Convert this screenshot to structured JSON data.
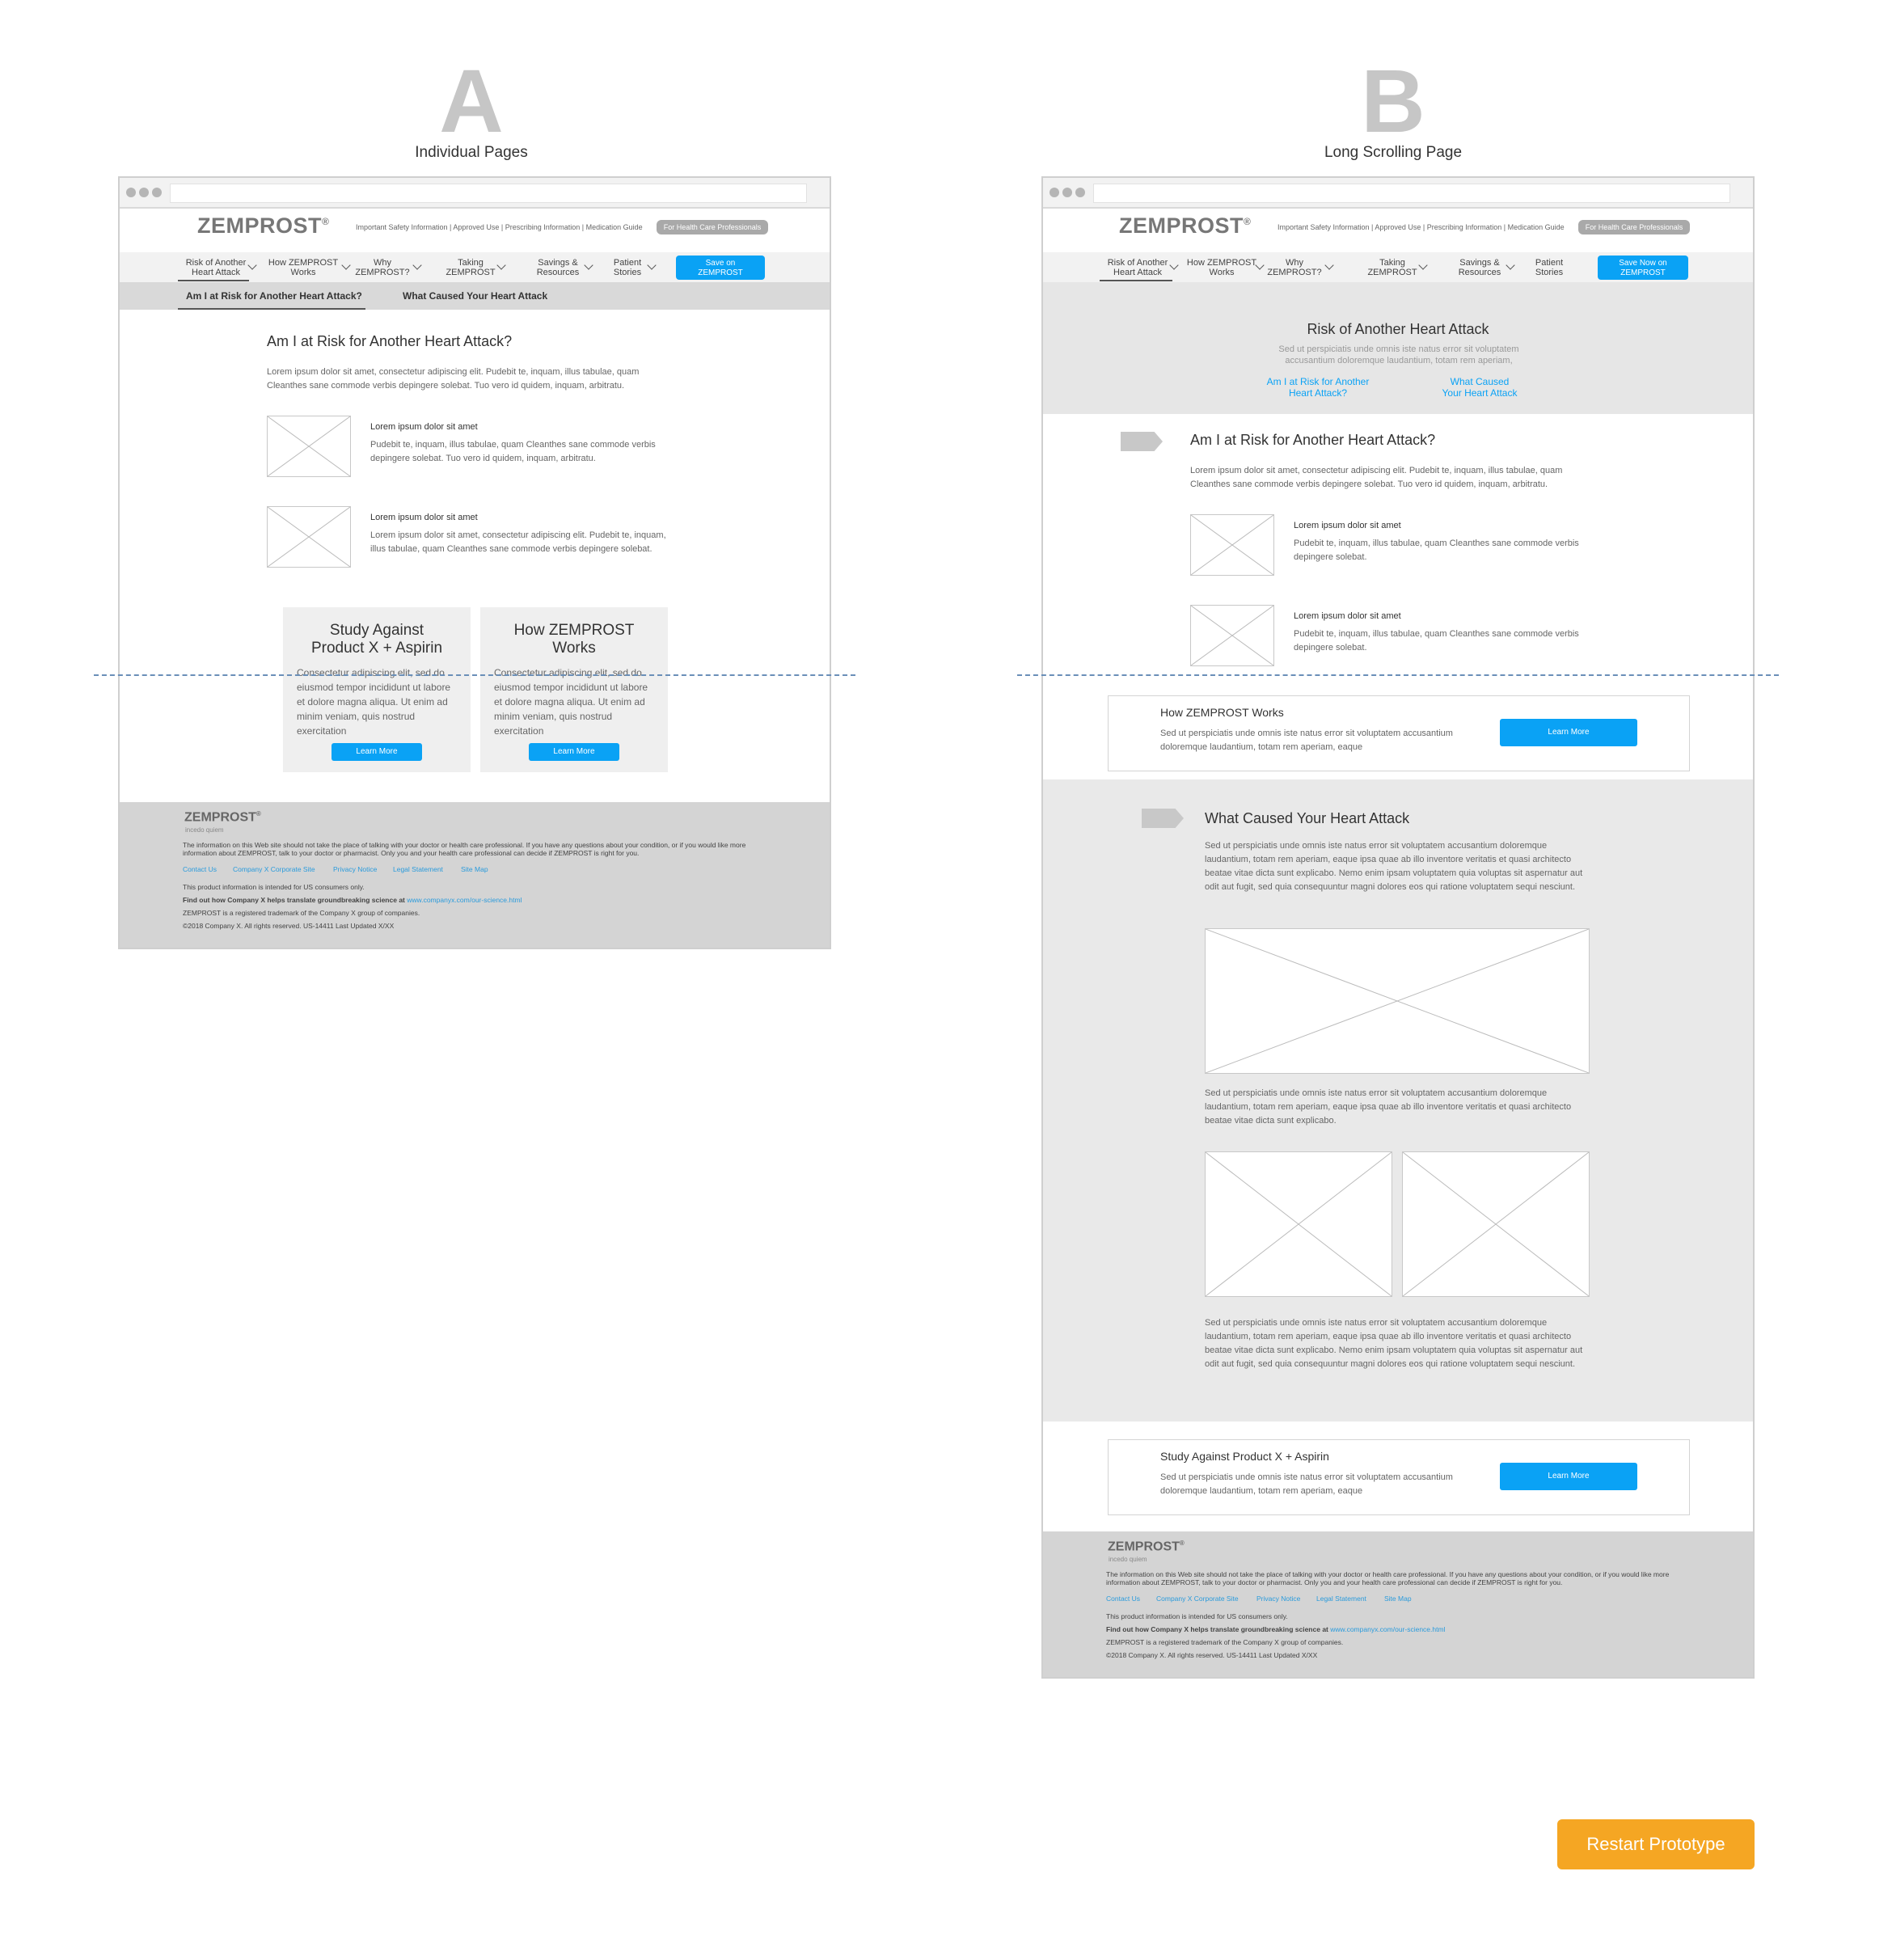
{
  "variant_a": {
    "letter": "A",
    "caption": "Individual Pages"
  },
  "variant_b": {
    "letter": "B",
    "caption": "Long Scrolling Page"
  },
  "brand": {
    "logo": "ZEMPROST",
    "reg": "®",
    "footer_tagline": "incedo quiem"
  },
  "top_links": "Important Safety Information | Approved Use | Prescribing Information | Medication Guide",
  "hcp_button": "For Health Care Professionals",
  "nav": [
    {
      "line1": "Risk of Another",
      "line2": "Heart Attack"
    },
    {
      "line1": "How ZEMPROST",
      "line2": "Works"
    },
    {
      "line1": "Why",
      "line2": "ZEMPROST?"
    },
    {
      "line1": "Taking",
      "line2": "ZEMPROST"
    },
    {
      "line1": "Savings &",
      "line2": "Resources"
    },
    {
      "line1": "Patient",
      "line2": "Stories"
    }
  ],
  "cta_a": {
    "line1": "Save on",
    "line2": "ZEMPROST"
  },
  "cta_b": {
    "line1": "Save Now on",
    "line2": "ZEMPROST"
  },
  "subnav_a": [
    "Am I at Risk for Another Heart Attack?",
    "What Caused Your Heart Attack"
  ],
  "page_a": {
    "heading": "Am I at Risk for Another Heart Attack?",
    "intro": "Lorem ipsum dolor sit amet, consectetur adipiscing elit. Pudebit te, inquam, illus tabulae, quam Cleanthes sane commode verbis depingere solebat. Tuo vero id quidem, inquam, arbitratu.",
    "item1_title": "Lorem ipsum dolor sit amet",
    "item1_text": "Pudebit te, inquam, illus tabulae, quam Cleanthes sane commode verbis depingere solebat. Tuo vero id quidem, inquam, arbitratu.",
    "item2_title": "Lorem ipsum dolor sit amet",
    "item2_text": "Lorem ipsum dolor sit amet, consectetur adipiscing elit. Pudebit te, inquam, illus tabulae, quam Cleanthes sane commode verbis depingere solebat.",
    "card1_title": "Study Against Product X + Aspirin",
    "card2_title": "How ZEMPROST Works",
    "card_text": "Consectetur adipiscing elit, sed do eiusmod tempor incididunt ut labore et dolore magna aliqua. Ut enim ad minim veniam, quis nostrud exercitation",
    "learn_more": "Learn More"
  },
  "page_b": {
    "hero_title": "Risk of Another Heart Attack",
    "hero_text": "Sed ut perspiciatis unde omnis iste natus error sit voluptatem accusantium doloremque laudantium, totam rem aperiam,",
    "hero_link1_l1": "Am I at Risk for Another",
    "hero_link1_l2": "Heart Attack?",
    "hero_link2_l1": "What Caused",
    "hero_link2_l2": "Your Heart Attack",
    "section1_heading": "Am I at Risk for Another Heart Attack?",
    "section1_intro": "Lorem ipsum dolor sit amet, consectetur adipiscing elit. Pudebit te, inquam, illus tabulae, quam Cleanthes sane commode verbis depingere solebat. Tuo vero id quidem, inquam, arbitratu.",
    "item1_title": "Lorem ipsum dolor sit amet",
    "item1_text": "Pudebit te, inquam, illus tabulae, quam Cleanthes sane commode verbis depingere solebat.",
    "item2_title": "Lorem ipsum dolor sit amet",
    "item2_text": "Pudebit te, inquam, illus tabulae, quam Cleanthes sane commode verbis depingere solebat.",
    "promo1_title": "How ZEMPROST Works",
    "promo_text": "Sed ut perspiciatis unde omnis iste natus error sit voluptatem accusantium doloremque laudantium, totam rem aperiam, eaque",
    "section2_heading": "What Caused Your Heart Attack",
    "section2_p1": "Sed ut perspiciatis unde omnis iste natus error sit voluptatem accusantium doloremque laudantium, totam rem aperiam, eaque ipsa quae ab illo inventore veritatis et quasi architecto beatae vitae dicta sunt explicabo. Nemo enim ipsam voluptatem quia voluptas sit aspernatur aut odit aut fugit, sed quia consequuntur magni dolores eos qui ratione voluptatem sequi nesciunt.",
    "section2_p2": "Sed ut perspiciatis unde omnis iste natus error sit voluptatem accusantium doloremque laudantium, totam rem aperiam, eaque ipsa quae ab illo inventore veritatis et quasi architecto beatae vitae dicta sunt explicabo.",
    "section2_p3": "Sed ut perspiciatis unde omnis iste natus error sit voluptatem accusantium doloremque laudantium, totam rem aperiam, eaque ipsa quae ab illo inventore veritatis et quasi architecto beatae vitae dicta sunt explicabo. Nemo enim ipsam voluptatem quia voluptas sit aspernatur aut odit aut fugit, sed quia consequuntur magni dolores eos qui ratione voluptatem sequi nesciunt.",
    "promo2_title": "Study Against Product X + Aspirin",
    "learn_more": "Learn More"
  },
  "footer": {
    "disclaimer": "The information on this Web site should not take the place of talking with your doctor or health care professional. If you have any questions about your condition, or if you would like more information about ZEMPROST, talk to your doctor or pharmacist. Only you and your health care professional can decide if ZEMPROST is right for you.",
    "links": [
      "Contact Us",
      "Company X Corporate Site",
      "Privacy Notice",
      "Legal Statement",
      "Site Map"
    ],
    "us_only": "This product information is intended for US consumers only.",
    "science_prefix": "Find out how Company X helps translate groundbreaking science at",
    "science_url": "www.companyx.com/our-science.html",
    "trademark": "ZEMPROST is a registered trademark of the Company X group of companies.",
    "copyright": "©2018 Company X. All rights reserved. US-14411 Last Updated X/XX"
  },
  "restart_button": "Restart Prototype"
}
